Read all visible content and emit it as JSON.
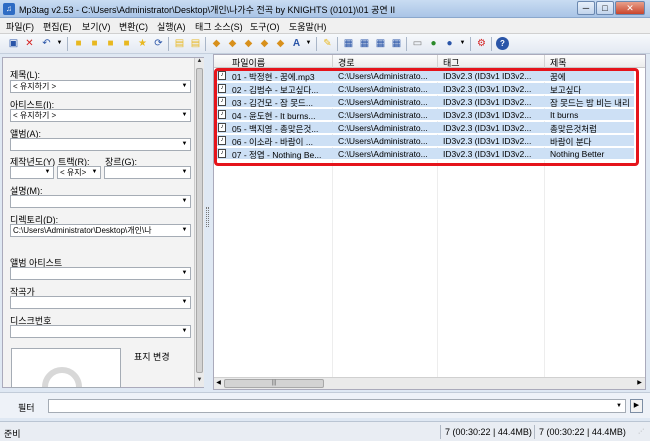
{
  "window": {
    "title": "Mp3tag v2.53  -  C:\\Users\\Administrator\\Desktop\\개인\\나가수 전곡 by KNIGHTS (0101)\\01 공연 II",
    "minimize": "─",
    "maximize": "□",
    "close": "✕"
  },
  "menu": [
    "파일(F)",
    "편집(E)",
    "보기(V)",
    "변환(C)",
    "실행(A)",
    "태그 소스(S)",
    "도구(O)",
    "도움말(H)"
  ],
  "toolbar": {
    "icons": [
      "save-icon",
      "remove-tag-icon",
      "undo-icon",
      "dropdown-icon",
      "add-directory-icon",
      "change-directory-icon",
      "folder-open-icon",
      "folder-up-icon",
      "favorites-star-icon",
      "refresh-icon",
      "copy-tag-icon",
      "paste-tag-icon",
      "tag-filename-icon",
      "filename-tag-icon",
      "filename-filename-icon",
      "text-tag-icon",
      "tag-text-icon",
      "case-convert-icon",
      "edit-tags-icon",
      "extended-tags-icon",
      "playlist-icon",
      "export-icon",
      "actions-icon",
      "freedb-icon",
      "discogs-icon",
      "web-sources-icon",
      "settings-icon",
      "help-icon"
    ],
    "colors": {
      "accent": "#2e6cc4",
      "folder": "#e8b820",
      "red": "#d42020"
    }
  },
  "leftpanel": {
    "title_label": "제목(L):",
    "title_value": "< 유지하기 >",
    "artist_label": "아티스트(I):",
    "artist_value": "< 유지하기 >",
    "album_label": "앨범(A):",
    "album_value": "",
    "year_label": "제작년도(Y)",
    "track_label": "트랙(R):",
    "genre_label": "장르(G):",
    "year_value": "",
    "track_value": "< 유지>",
    "genre_value": "",
    "comment_label": "설명(M):",
    "comment_value": "",
    "directory_label": "디렉토리(D):",
    "directory_value": "C:\\Users\\Administrator\\Desktop\\개인\\나",
    "album_artist_label": "앨범 아티스트",
    "album_artist_value": "",
    "composer_label": "작곡가",
    "composer_value": "",
    "disc_label": "디스크번호",
    "disc_value": "",
    "cover_label": "표지 변경"
  },
  "grid": {
    "columns": [
      "파일이름",
      "경로",
      "태그",
      "제목"
    ],
    "rows": [
      {
        "filename": "01 - 박정현 - 꿈에.mp3",
        "path": "C:\\Users\\Administrato...",
        "tag": "ID3v2.3 (ID3v1 ID3v2...",
        "title": "꿈에"
      },
      {
        "filename": "02 - 김범수 - 보고싶다...",
        "path": "C:\\Users\\Administrato...",
        "tag": "ID3v2.3 (ID3v1 ID3v2...",
        "title": "보고싶다"
      },
      {
        "filename": "03 - 김건모 - 잠 못드...",
        "path": "C:\\Users\\Administrato...",
        "tag": "ID3v2.3 (ID3v1 ID3v2...",
        "title": "잠 못드는 밤 비는 내리"
      },
      {
        "filename": "04 - 윤도현 - It burns...",
        "path": "C:\\Users\\Administrato...",
        "tag": "ID3v2.3 (ID3v1 ID3v2...",
        "title": "It burns"
      },
      {
        "filename": "05 - 백지영 - 총맞은것...",
        "path": "C:\\Users\\Administrato...",
        "tag": "ID3v2.3 (ID3v1 ID3v2...",
        "title": "총맞은것처럼"
      },
      {
        "filename": "06 - 이소라 - 바람이 ...",
        "path": "C:\\Users\\Administrato...",
        "tag": "ID3v2.3 (ID3v1 ID3v2...",
        "title": "바람이 분다"
      },
      {
        "filename": "07 - 정엽 - Nothing Be...",
        "path": "C:\\Users\\Administrato...",
        "tag": "ID3v2.3 (ID3v1 ID3v2...",
        "title": "Nothing Better"
      }
    ],
    "selection_color": "#cde0f5",
    "highlight_color": "#e5141b"
  },
  "filter": {
    "label": "필터",
    "value": ""
  },
  "status": {
    "left": "준비",
    "middle": "7 (00:30:22 | 44.4MB)",
    "right": "7 (00:30:22 | 44.4MB)"
  }
}
